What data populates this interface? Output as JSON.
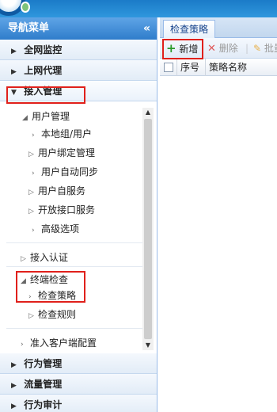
{
  "nav": {
    "title": "导航菜单",
    "collapse_glyph": "«",
    "sections": [
      {
        "label": "全网监控"
      },
      {
        "label": "上网代理"
      },
      {
        "label": "接入管理"
      }
    ],
    "tree": {
      "group1": "用户管理",
      "group1_items": [
        "本地组/用户",
        "用户绑定管理",
        "用户自动同步",
        "用户自服务",
        "开放接口服务",
        "高级选项"
      ],
      "group2": "接入认证",
      "group3": "终端检查",
      "group3_items": [
        "检查策略",
        "检查规则"
      ],
      "group4": "准入客户端配置"
    },
    "bottom_sections": [
      {
        "label": "行为管理"
      },
      {
        "label": "流量管理"
      },
      {
        "label": "行为审计"
      }
    ]
  },
  "main": {
    "tab": "检查策略",
    "toolbar": {
      "add": "新增",
      "delete": "删除",
      "batch": "批量"
    },
    "grid": {
      "columns": [
        "序号",
        "策略名称"
      ]
    }
  },
  "colors": {
    "highlight": "#e0201b",
    "header_blue": "#2f7dcb",
    "add_green": "#2a9a2a",
    "delete_red": "#e05a5a"
  }
}
